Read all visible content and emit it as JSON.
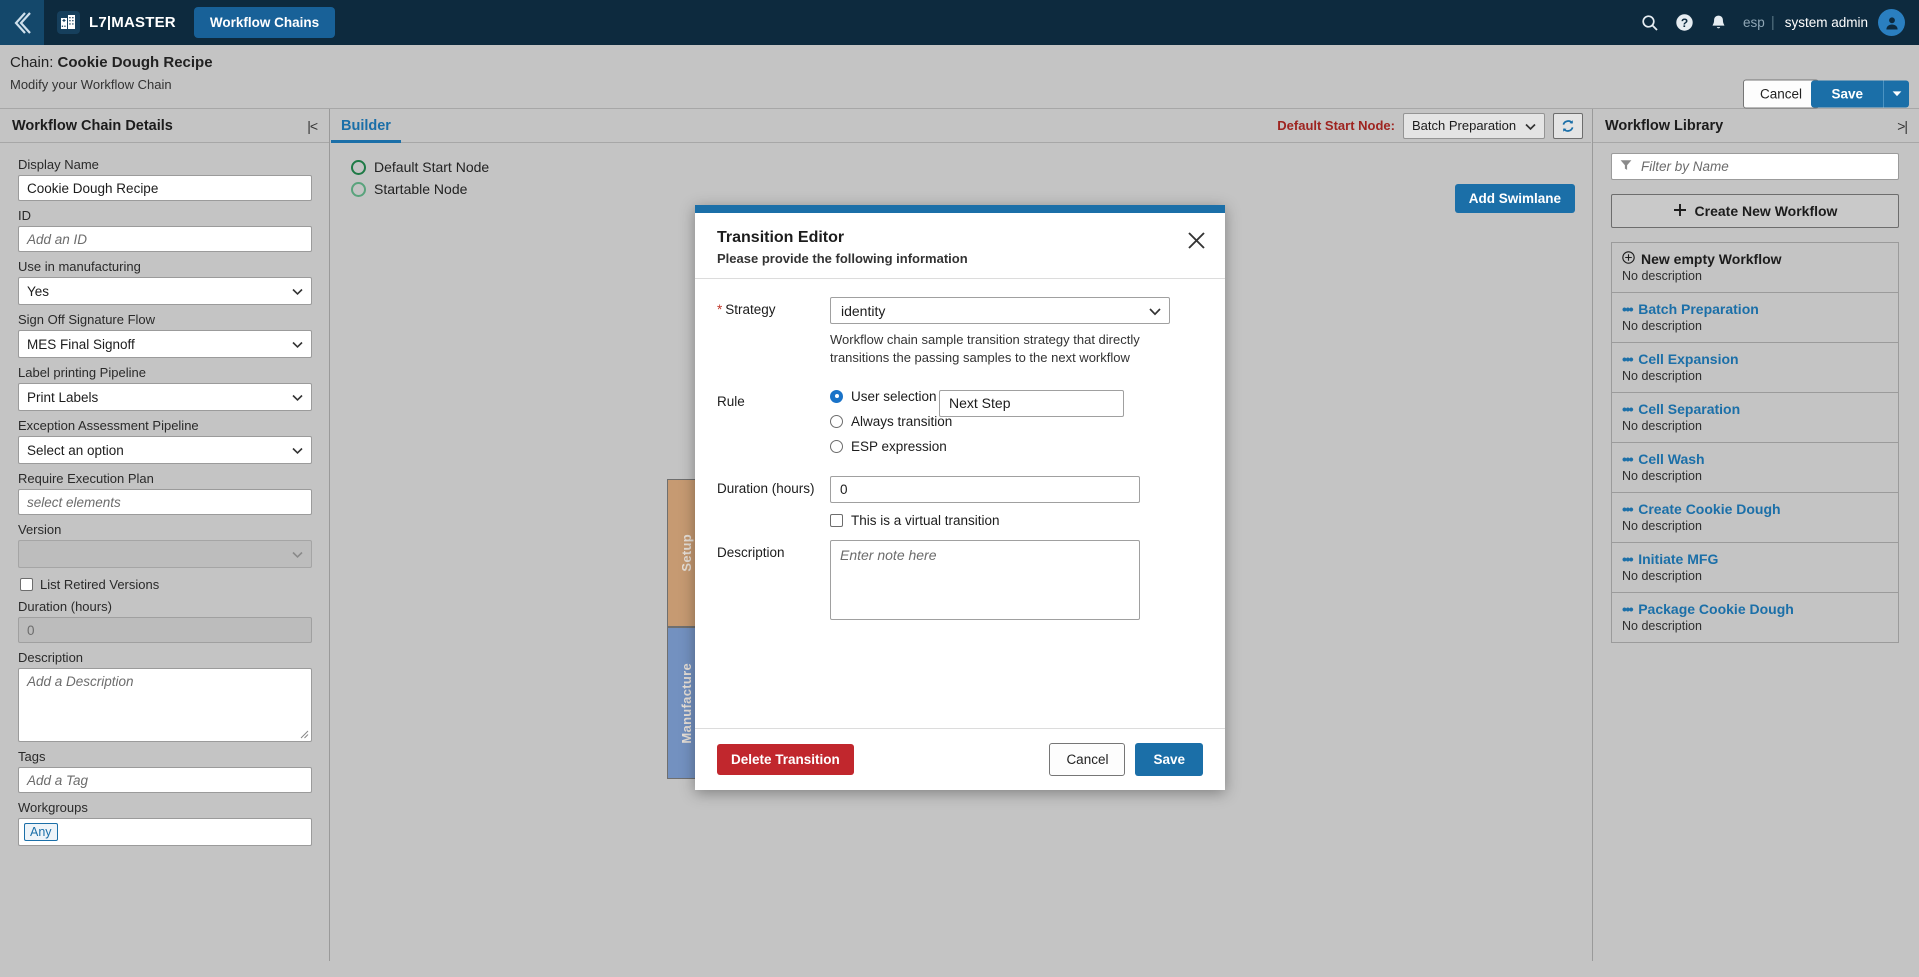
{
  "topnav": {
    "back_icon": "chevron-left-double-icon",
    "brand_logo_icon": "factory-add-icon",
    "brand": "L7|MASTER",
    "tab_label": "Workflow Chains",
    "search_icon": "search-icon",
    "help_icon": "help-circle-icon",
    "bell_icon": "notification-bell-icon",
    "language": "esp",
    "separator": "|",
    "user": "system admin",
    "avatar_icon": "user-avatar-icon"
  },
  "pageheader": {
    "prefix": "Chain: ",
    "chain_name": "Cookie Dough Recipe",
    "subtitle": "Modify your Workflow Chain",
    "cancel_label": "Cancel",
    "save_label": "Save",
    "save_caret_icon": "caret-down-icon"
  },
  "left_panel": {
    "title": "Workflow Chain Details",
    "collapse_icon": "collapse-left-icon",
    "fields": {
      "display_name_label": "Display Name",
      "display_name_value": "Cookie Dough Recipe",
      "id_label": "ID",
      "id_placeholder": "Add an ID",
      "use_in_manufacturing_label": "Use in manufacturing",
      "use_in_manufacturing_value": "Yes",
      "sign_off_label": "Sign Off Signature Flow",
      "sign_off_value": "MES Final Signoff",
      "label_printing_label": "Label printing Pipeline",
      "label_printing_value": "Print Labels",
      "exception_label": "Exception Assessment Pipeline",
      "exception_value": "Select an option",
      "require_exec_label": "Require Execution Plan",
      "require_exec_placeholder": "select elements",
      "version_label": "Version",
      "version_value": "",
      "list_retired_label": "List Retired Versions",
      "duration_label": "Duration (hours)",
      "duration_value": "0",
      "description_label": "Description",
      "description_placeholder": "Add a Description",
      "tags_label": "Tags",
      "tags_placeholder": "Add a Tag",
      "workgroups_label": "Workgroups",
      "workgroups_chip": "Any"
    }
  },
  "builder": {
    "tab_label": "Builder",
    "default_start_node_label": "Default Start Node:",
    "default_start_node_value": "Batch Preparation",
    "refresh_icon": "refresh-icon",
    "legend": [
      {
        "label": "Default Start Node",
        "color": "#1e7a46"
      },
      {
        "label": "Startable Node",
        "color": "#59a37c"
      }
    ],
    "add_swimlane_label": "Add Swimlane",
    "swimlanes": [
      {
        "label": "Setup",
        "color": "#c69a72"
      },
      {
        "label": "Manufacture",
        "color": "#7391c0"
      }
    ]
  },
  "right_panel": {
    "title": "Workflow Library",
    "collapse_icon": "collapse-right-icon",
    "filter_icon": "filter-icon",
    "filter_placeholder": "Filter by Name",
    "create_icon": "plus-icon",
    "create_label": "Create New Workflow",
    "items": [
      {
        "icon": "plus-circle-icon",
        "name": "New empty Workflow",
        "desc": "No description"
      },
      {
        "icon": "dots-icon",
        "name": "Batch Preparation",
        "desc": "No description"
      },
      {
        "icon": "dots-icon",
        "name": "Cell Expansion",
        "desc": "No description"
      },
      {
        "icon": "dots-icon",
        "name": "Cell Separation",
        "desc": "No description"
      },
      {
        "icon": "dots-icon",
        "name": "Cell Wash",
        "desc": "No description"
      },
      {
        "icon": "dots-icon",
        "name": "Create Cookie Dough",
        "desc": "No description"
      },
      {
        "icon": "dots-icon",
        "name": "Initiate MFG",
        "desc": "No description"
      },
      {
        "icon": "dots-icon",
        "name": "Package Cookie Dough",
        "desc": "No description"
      }
    ]
  },
  "modal": {
    "title": "Transition Editor",
    "subtitle": "Please provide the following information",
    "close_icon": "close-icon",
    "strategy_required_mark": "*",
    "strategy_label": "Strategy",
    "strategy_value": "identity",
    "strategy_help": "Workflow chain sample transition strategy that directly transitions the passing samples to the next workflow",
    "rule_label": "Rule",
    "rule_options": [
      {
        "label": "User selection",
        "selected": true
      },
      {
        "label": "Always transition",
        "selected": false
      },
      {
        "label": "ESP expression",
        "selected": false
      }
    ],
    "rule_value": "Next Step",
    "duration_label": "Duration (hours)",
    "duration_value": "0",
    "virtual_label": "This is a virtual transition",
    "description_label": "Description",
    "description_placeholder": "Enter note here",
    "delete_label": "Delete Transition",
    "cancel_label": "Cancel",
    "save_label": "Save"
  },
  "colors": {
    "nav_bg": "#0d2a3e",
    "accent_blue": "#1b6fa8",
    "danger_red": "#c1272d",
    "required_red": "#c0392b",
    "page_bg": "#c4c4c4"
  }
}
